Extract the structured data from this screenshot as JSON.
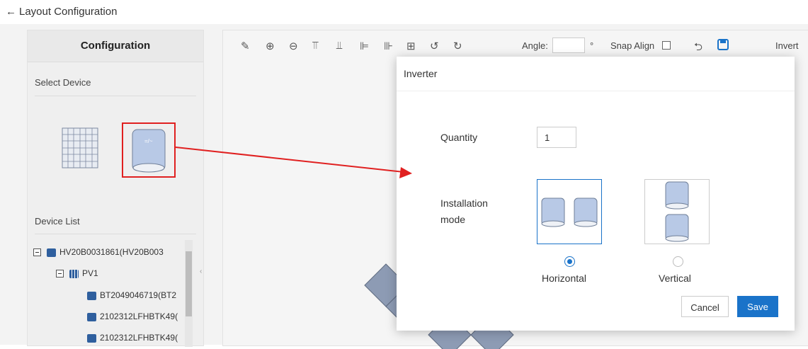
{
  "header": {
    "back_arrow": "←",
    "title": "Layout Configuration"
  },
  "left_panel": {
    "title": "Configuration",
    "select_device_label": "Select Device",
    "device_list_label": "Device List",
    "inverter_glyph": "=/~",
    "tree": [
      {
        "label": "HV20B0031861(HV20B003",
        "level": 0,
        "icon": "device-icon"
      },
      {
        "label": "PV1",
        "level": 1,
        "icon": "pv-array-icon"
      },
      {
        "label": "BT2049046719(BT2",
        "level": 2,
        "icon": "device-icon"
      },
      {
        "label": "2102312LFHBTK49(",
        "level": 2,
        "icon": "device-icon"
      },
      {
        "label": "2102312LFHBTK49(",
        "level": 2,
        "icon": "device-icon"
      }
    ]
  },
  "toolbar": {
    "icons": [
      "eraser-icon",
      "zoom-in-icon",
      "zoom-out-icon",
      "align-top-icon",
      "align-bottom-icon",
      "align-left-icon",
      "align-right-icon",
      "align-center-icon",
      "rotate-left-icon",
      "rotate-right-icon"
    ],
    "angle_label": "Angle:",
    "degree": "°",
    "snap_label": "Snap Align",
    "right_text": "Invert"
  },
  "modal": {
    "title": "Inverter",
    "quantity_label": "Quantity",
    "quantity_value": "1",
    "mode_label_1": "Installation",
    "mode_label_2": "mode",
    "horizontal_label": "Horizontal",
    "vertical_label": "Vertical",
    "selected_mode": "Horizontal",
    "cancel_label": "Cancel",
    "save_label": "Save",
    "inverter_glyph": "=/~"
  },
  "colors": {
    "accent": "#1a73c9",
    "highlight_red": "#e02020",
    "node_blue": "#2f5f9e",
    "inverter_fill": "#b8c9e6"
  }
}
